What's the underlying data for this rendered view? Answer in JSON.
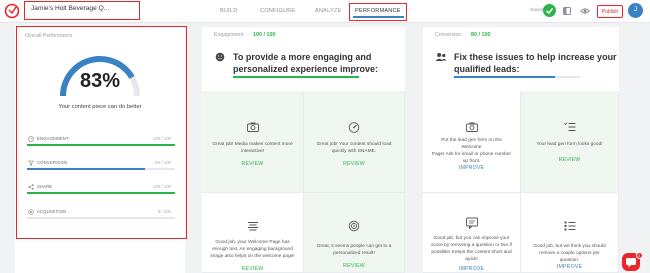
{
  "header": {
    "title": "Jamie's Holt Beverage Q...",
    "nav": [
      "BUILD",
      "CONFIGURE",
      "ANALYZE",
      "PERFORMANCE"
    ],
    "saved_label": "Saved",
    "publish_label": "Publish",
    "avatar_letter": "J"
  },
  "overall": {
    "title": "Overall Performance",
    "score": "83%",
    "gauge_fraction": 0.83,
    "message": "Your content piece can do better",
    "metrics": [
      {
        "name": "ENGAGEMENT",
        "score": "100 / 100",
        "fraction": 1.0,
        "color": "#2cb34a"
      },
      {
        "name": "CONVERSION",
        "score": "80 / 100",
        "fraction": 0.8,
        "color": "#3b82c4"
      },
      {
        "name": "SHARE",
        "score": "100 / 100",
        "fraction": 1.0,
        "color": "#2cb34a"
      },
      {
        "name": "ACQUISITION",
        "score": "0 / 100",
        "fraction": 0.0,
        "color": "#2cb34a"
      }
    ]
  },
  "engagement": {
    "label": "Engagement",
    "score": "100 / 100",
    "heading_line1": "To provide a more engaging and",
    "heading_line2": "personalized experience improve:",
    "fraction": 1.0,
    "color": "#2cb34a",
    "cards": [
      {
        "icon": "camera-icon",
        "text": [
          "Great job! Media makes content more",
          "interactive!"
        ],
        "action": "REVIEW"
      },
      {
        "icon": "speedometer-icon",
        "text": [
          "Great job! Your content should load",
          "quickly with SNAME."
        ],
        "action": "REVIEW"
      },
      {
        "icon": "text-align-icon",
        "text": [
          "Good job, your Welcome Page has",
          "enough text. An engaging background",
          "image also helps on the welcome page!"
        ],
        "action": "REVIEW"
      },
      {
        "icon": "target-icon",
        "text": [
          "Great, it seems people can get to a",
          "personalized result!"
        ],
        "action": "REVIEW"
      }
    ]
  },
  "conversion": {
    "label": "Conversion",
    "score": "80 / 100",
    "heading_line1": "Fix these issues to help increase your",
    "heading_line2": "qualified leads:",
    "fraction": 0.8,
    "color": "#3b82c4",
    "cards": [
      {
        "icon": "camera-icon",
        "text": [
          "Put the lead gen form on the Welcome",
          "Page! Ask for email or phone number",
          "up front."
        ],
        "action": "IMPROVE"
      },
      {
        "icon": "checklist-icon",
        "text": [
          "Your lead gen form looks good!"
        ],
        "action": "REVIEW"
      },
      {
        "icon": "chat-icon",
        "text": [
          "Good job, but you can improve your",
          "score by removing a question or two if",
          "possible! Keeps the content short and",
          "quick!"
        ],
        "action": "IMPROVE"
      },
      {
        "icon": "list-icon",
        "text": [
          "Good job, but we think you should",
          "remove a couple options per question."
        ],
        "action": "IMPROVE"
      }
    ]
  },
  "chat": {
    "badge": "1"
  }
}
